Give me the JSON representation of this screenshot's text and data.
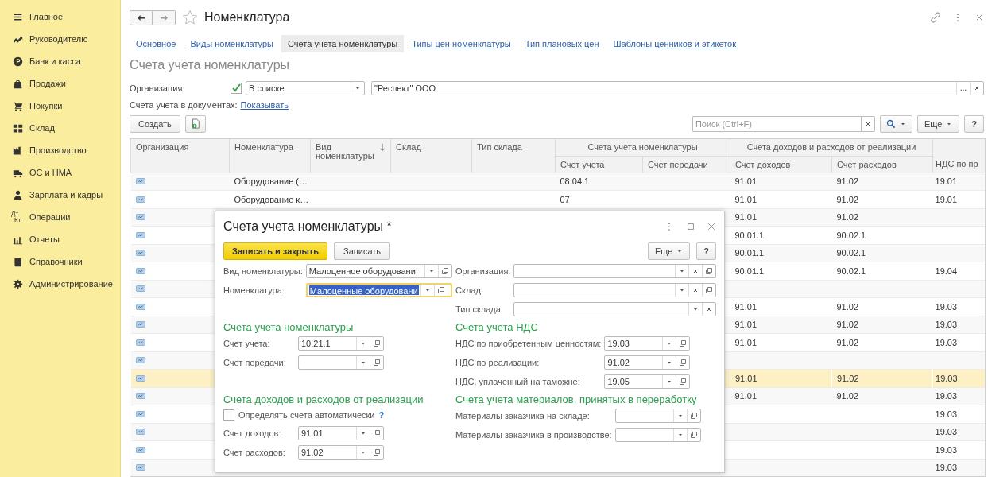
{
  "sidebar": {
    "items": [
      {
        "label": "Главное"
      },
      {
        "label": "Руководителю"
      },
      {
        "label": "Банк и касса"
      },
      {
        "label": "Продажи"
      },
      {
        "label": "Покупки"
      },
      {
        "label": "Склад"
      },
      {
        "label": "Производство"
      },
      {
        "label": "ОС и НМА"
      },
      {
        "label": "Зарплата и кадры"
      },
      {
        "label": "Операции",
        "icon_lines": [
          "Дт",
          "Кт"
        ]
      },
      {
        "label": "Отчеты"
      },
      {
        "label": "Справочники"
      },
      {
        "label": "Администрирование"
      }
    ]
  },
  "window": {
    "title": "Номенклатура"
  },
  "tabs": [
    {
      "label": "Основное",
      "selected": false
    },
    {
      "label": "Виды номенклатуры",
      "selected": false
    },
    {
      "label": "Счета учета номенклатуры",
      "selected": true
    },
    {
      "label": "Типы цен номенклатуры",
      "selected": false
    },
    {
      "label": "Тип плановых цен",
      "selected": false
    },
    {
      "label": "Шаблоны ценников и этикеток",
      "selected": false
    }
  ],
  "page_title": "Счета учета номенклатуры",
  "filter": {
    "label": "Организация:",
    "checked": true,
    "condition": "В списке",
    "value": "\"Респект\" ООО"
  },
  "documents": {
    "label": "Счета учета в документах:",
    "link": "Показывать"
  },
  "toolbar": {
    "create": "Создать",
    "search_placeholder": "Поиск (Ctrl+F)",
    "more": "Еще",
    "help": "?"
  },
  "table": {
    "columns": [
      {
        "kind": "column",
        "label": "Организация",
        "sorted": false
      },
      {
        "kind": "column",
        "label": "Номенклатура",
        "sorted": false
      },
      {
        "kind": "column",
        "label": "Вид номенклатуры",
        "sorted": true
      },
      {
        "kind": "column",
        "label": "Склад",
        "sorted": false
      },
      {
        "kind": "column",
        "label": "Тип склада",
        "sorted": false
      },
      {
        "kind": "group",
        "label": "Счета учета номенклатуры",
        "columns": [
          "Счет учета",
          "Счет передачи"
        ]
      },
      {
        "kind": "group",
        "label": "Счета доходов и расходов от реализации",
        "columns": [
          "Счет доходов",
          "Счет расходов"
        ]
      },
      {
        "kind": "lower",
        "label": "НДС по пр"
      }
    ],
    "rows": [
      {
        "selected": false,
        "nomenclature": "Оборудование (…",
        "account": "08.04.1",
        "income": "91.01",
        "expense": "91.02",
        "vat": "19.01"
      },
      {
        "selected": false,
        "nomenclature": "Оборудование к…",
        "account": "07",
        "income": "91.01",
        "expense": "91.02",
        "vat": "19.01"
      },
      {
        "selected": false,
        "income": "91.01",
        "expense": "91.02"
      },
      {
        "selected": false,
        "income": "90.01.1",
        "expense": "90.02.1"
      },
      {
        "selected": false,
        "income": "90.01.1",
        "expense": "90.02.1"
      },
      {
        "selected": false,
        "income": "90.01.1",
        "expense": "90.02.1",
        "vat": "19.04"
      },
      {
        "selected": false
      },
      {
        "selected": false,
        "income": "91.01",
        "expense": "91.02",
        "vat": "19.03"
      },
      {
        "selected": false,
        "income": "91.01",
        "expense": "91.02",
        "vat": "19.03"
      },
      {
        "selected": false,
        "income": "91.01",
        "expense": "91.02",
        "vat": "19.03"
      },
      {
        "selected": false
      },
      {
        "selected": true,
        "income": "91.01",
        "expense": "91.02",
        "vat": "19.03"
      },
      {
        "selected": false,
        "income": "91.01",
        "expense": "91.02",
        "vat": "19.03"
      },
      {
        "selected": false,
        "vat": "19.03"
      },
      {
        "selected": false,
        "vat": "19.03"
      },
      {
        "selected": false,
        "vat": "19.03"
      },
      {
        "selected": false,
        "vat": "19.03"
      }
    ]
  },
  "dialog": {
    "title": "Счета учета номенклатуры *",
    "buttons": [
      {
        "label": "Записать и закрыть",
        "kind": "primary"
      },
      {
        "label": "Записать",
        "kind": "default"
      }
    ],
    "more": "Еще",
    "help": "?",
    "left_fields": [
      {
        "label": "Вид номенклатуры:",
        "value": "Малоценное оборудовани",
        "focused": false,
        "clear": false
      },
      {
        "label": "Номенклатура:",
        "value": "Малоценные оборудовани",
        "focused": true,
        "clear": false
      }
    ],
    "right_fields": [
      {
        "label": "Организация:",
        "clear": true,
        "open": true
      },
      {
        "label": "Склад:",
        "clear": true,
        "open": true
      },
      {
        "label": "Тип склада:",
        "clear": true,
        "open": false
      }
    ],
    "sections": [
      {
        "title": "Счета учета номенклатуры",
        "items": [
          {
            "kind": "field",
            "label": "Счет учета:",
            "value": "10.21.1"
          },
          {
            "kind": "field",
            "label": "Счет передачи:"
          }
        ]
      },
      {
        "title": "Счета учета НДС",
        "items": [
          {
            "kind": "field",
            "label": "НДС по приобретенным ценностям:",
            "value": "19.03"
          },
          {
            "kind": "field",
            "label": "НДС по реализации:",
            "value": "91.02"
          },
          {
            "kind": "field",
            "label": "НДС, уплаченный на таможне:",
            "value": "19.05"
          }
        ]
      },
      {
        "title": "Счета доходов и расходов от реализации",
        "items": [
          {
            "kind": "checkbox",
            "label": "Определять счета автоматически",
            "checked": false,
            "help": "?"
          },
          {
            "kind": "field",
            "label": "Счет доходов:",
            "value": "91.01"
          },
          {
            "kind": "field",
            "label": "Счет расходов:",
            "value": "91.02"
          }
        ]
      },
      {
        "title": "Счета учета материалов, принятых в переработку",
        "items": [
          {
            "kind": "field",
            "label": "Материалы заказчика на складе:"
          },
          {
            "kind": "field",
            "label": "Материалы заказчика в производстве:"
          }
        ]
      }
    ]
  }
}
